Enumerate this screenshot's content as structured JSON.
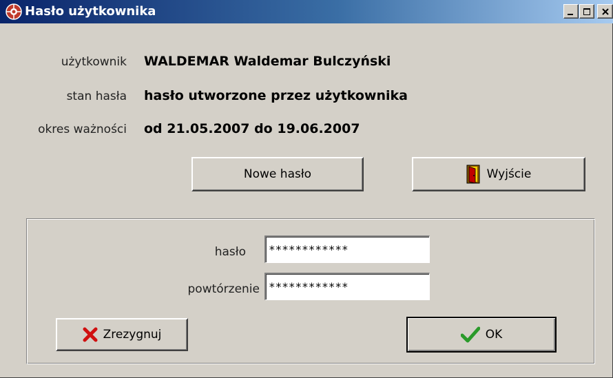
{
  "window": {
    "title": "Hasło użytkownika",
    "title_bar_gradient": [
      "#0a246a",
      "#a6caf0"
    ],
    "background_color": "#d4d0c8"
  },
  "info": {
    "user_label": "użytkownik",
    "user_value": "WALDEMAR Waldemar Bulczyński",
    "status_label": "stan hasła",
    "status_value": "hasło utworzone przez użytkownika",
    "validity_label": "okres ważności",
    "validity_value": "od 21.05.2007 do 19.06.2007"
  },
  "buttons": {
    "new_password": "Nowe hasło",
    "exit": "Wyjście",
    "cancel": "Zrezygnuj",
    "ok": "OK"
  },
  "form": {
    "password_label": "hasło",
    "password_value": "************",
    "repeat_label": "powtórzenie",
    "repeat_value": "************"
  },
  "icons": {
    "app": "app-icon",
    "exit": "exit-door-icon",
    "cancel": "red-x-icon",
    "ok": "green-check-icon"
  }
}
